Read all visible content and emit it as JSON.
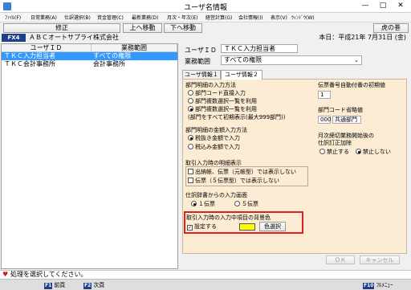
{
  "window": {
    "title": "ユーザ名情報",
    "minimize": "—",
    "maximize": "□",
    "close": "✕",
    "app_icon": "app-icon"
  },
  "menu": [
    "ﾌｧｲﾙ(F)",
    "日常業務(A)",
    "仕訳選択(B)",
    "資金管理(C)",
    "最新業務(D)",
    "月次・年次(E)",
    "経営計算(G)",
    "会社情報(I)",
    "表示(V)",
    "ｳｨﾝﾄﾞｳ(W)"
  ],
  "toolbar": {
    "fix": "修正",
    "prev_page": "上へ移動",
    "next_page": "下へ移動",
    "tora": "虎の巻"
  },
  "info": {
    "fkey": "FX4",
    "company": "ＡＢＣオートサプライ株式会社",
    "date": "本日：平成21年 7月31日 (金)"
  },
  "user_list": {
    "headers": [
      "ユーザＩＤ",
      "業務範囲"
    ],
    "rows": [
      [
        "ＴＫＣ入力担当者",
        "すべての権限"
      ],
      [
        "ＴＫＣ会計事務所",
        "会計事務所"
      ]
    ]
  },
  "form": {
    "user_id_label": "ユーザＩＤ",
    "user_id_value": "ＴＫＣ入力担当者",
    "scope_label": "業務範囲",
    "scope_value": "すべての権限"
  },
  "tabs": [
    "ユーザ情報１",
    "ユーザ情報２"
  ],
  "tab2": {
    "dept_input_title": "部門明細の入力方法",
    "dept_input_opts": [
      "部門コード直接入力",
      "部門複数選択一覧を利用",
      "部門複数選択一覧を利用"
    ],
    "dept_input_note": "(部門をすべて初期表示(最大999部門))",
    "amount_title": "部門明細の金額入力方法",
    "amount_opts": [
      "税抜き金額で入力",
      "税込み金額で入力"
    ],
    "slip_title": "取引入力時の明細表示",
    "slip_opts": [
      "出納帳、伝票（元帳型）では表示しない",
      "伝票（５伝票型）では表示しない"
    ],
    "dict_title": "仕訳辞書からの入力画面",
    "dict_opts": [
      "１伝票",
      "５伝票"
    ],
    "bg_title": "取引入力時の入力中項目の背景色",
    "bg_check": "設定する",
    "bg_color": "#ffff00",
    "bg_button": "色選択",
    "voucher_title": "伝票番号自動付番の初期値",
    "voucher_value": "1",
    "dept_abbr_title": "部門コード省略値",
    "dept_abbr_code": "000",
    "dept_abbr_name": "共通部門",
    "monthly_title1": "月次締切業務開始後の",
    "monthly_title2": "仕訳訂正加除",
    "monthly_opts": [
      "禁止する",
      "禁止しない"
    ]
  },
  "buttons": {
    "ok": "ＯＫ",
    "cancel": "キャンセル"
  },
  "status": {
    "icon": "heart-icon",
    "text": "処理を選択してください。"
  },
  "fkeys": [
    {
      "key": "F1",
      "label": "前頁"
    },
    {
      "key": "F2",
      "label": "次頁"
    },
    {
      "key": "F10",
      "label": "ﾌﾙﾒﾆｭｰ"
    }
  ]
}
